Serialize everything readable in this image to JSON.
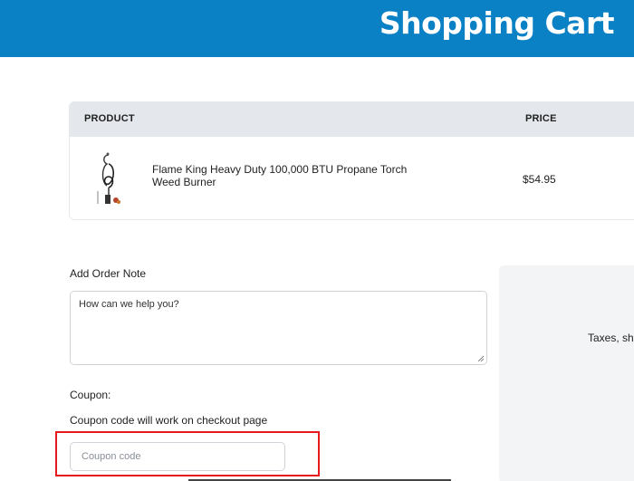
{
  "header": {
    "title": "Shopping Cart",
    "bg_color": "#0a80c5"
  },
  "cart_table": {
    "columns": {
      "product": "PRODUCT",
      "price": "PRICE"
    },
    "rows": [
      {
        "image_icon": "weed-burner-torch-image",
        "name": "Flame King Heavy Duty 100,000 BTU Propane Torch Weed Burner",
        "price": "$54.95"
      }
    ]
  },
  "order_note": {
    "label": "Add Order Note",
    "placeholder": "How can we help you?"
  },
  "coupon": {
    "label": "Coupon:",
    "hint": "Coupon code will work on checkout page",
    "placeholder": "Coupon code",
    "highlight_color": "#e8191d"
  },
  "summary": {
    "text_partial": "Taxes, sh"
  }
}
